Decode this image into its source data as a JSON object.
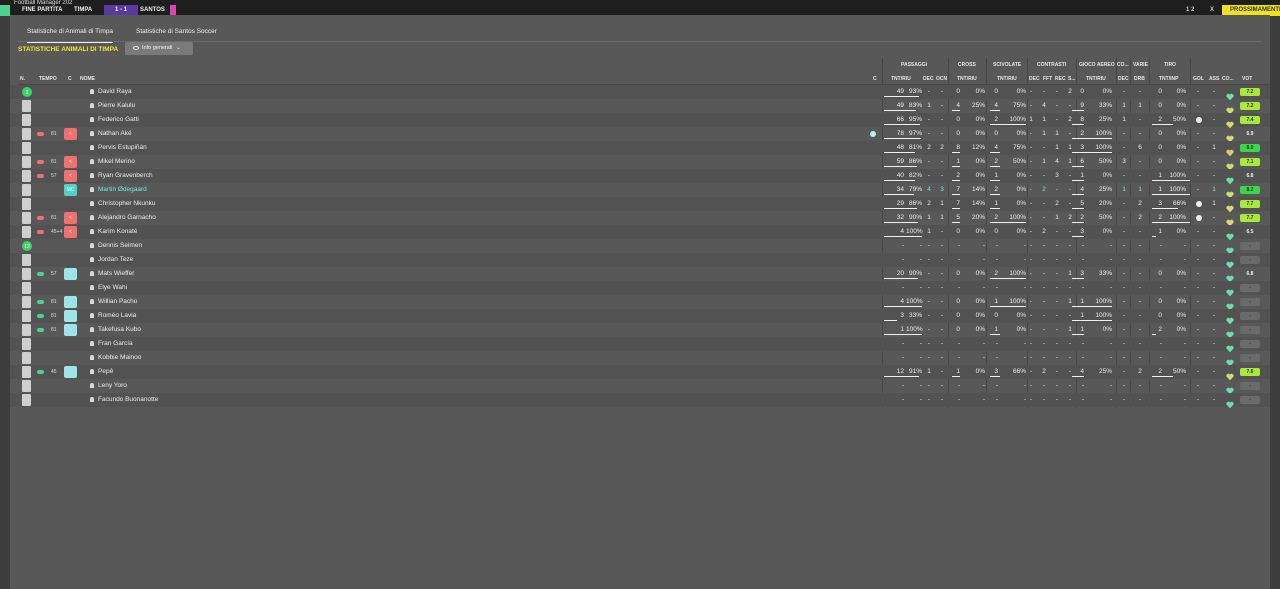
{
  "top_bar": {
    "title_snippet": "Football Manager 202",
    "status": "FINE PARTITA",
    "home": "TIMPA",
    "score": "1 - 1",
    "away": "SANTOS",
    "right_score": "1 2",
    "right_close": "X",
    "right_button": "PROSSIMAMENTE"
  },
  "tabs": [
    {
      "label": "Statistiche di Animali di Timpa",
      "active": true
    },
    {
      "label": "Statistiche di Santos Soccer",
      "active": false
    }
  ],
  "heading": "STATISTICHE ANIMALI DI TIMPA",
  "dropdown": {
    "icon": "eye-icon",
    "label": "Info generali",
    "chevron": "chevron-down-icon"
  },
  "columns": {
    "groups": [
      "PASSAGGI",
      "CROSS",
      "SCIVOLATE",
      "CONTRASTI",
      "GIOCO AEREO",
      "CO...",
      "VARIE",
      "TIRO"
    ],
    "left": [
      "N.",
      "TEMPO",
      "C",
      "NOME",
      "C"
    ],
    "stats": [
      "TNT/RIU",
      "DEC",
      "OCN",
      "TNT/RIU",
      "TNT/RIU",
      "DEC",
      "FFT",
      "REC",
      "S...",
      "TNT/RIU",
      "DEC",
      "DRB",
      "TNT/INP",
      "GOL",
      "ASS",
      "CO...",
      "VOT"
    ]
  },
  "players": [
    {
      "name": "David Raya",
      "kit": "1",
      "kit_style": "green",
      "time": "",
      "pos": "",
      "pos_style": "",
      "sub": "",
      "pass": [
        "49",
        "93%"
      ],
      "pass_bar": 0.93,
      "dec": "-",
      "ocn": "-",
      "cross": [
        "0",
        "0%"
      ],
      "scivolate": [
        "0",
        "0%"
      ],
      "contrasti": [
        "-",
        "-",
        "-",
        "2"
      ],
      "aereo": [
        "0",
        "0%"
      ],
      "co": "-",
      "drb": "-",
      "tiro": [
        "0",
        "0%"
      ],
      "tiro_bar": 0,
      "gol": "-",
      "ass": "-",
      "heart": "#6fe0a2",
      "vote": "7.2",
      "vote_bg": "#a8e83c",
      "dot": false,
      "ball": false
    },
    {
      "name": "Pierre Kalulu",
      "kit": "",
      "kit_style": "grey",
      "time": "",
      "pos": "",
      "pos_style": "",
      "sub": "",
      "pass": [
        "49",
        "83%"
      ],
      "pass_bar": 0.83,
      "dec": "1",
      "ocn": "-",
      "cross": [
        "4",
        "25%"
      ],
      "scivolate": [
        "4",
        "75%"
      ],
      "contrasti": [
        "-",
        "4",
        "-",
        "-"
      ],
      "aereo": [
        "9",
        "33%"
      ],
      "co": "1",
      "drb": "1",
      "tiro": [
        "0",
        "0%"
      ],
      "tiro_bar": 0,
      "gol": "-",
      "ass": "-",
      "heart": "#c7e06f",
      "vote": "7.2",
      "vote_bg": "#a8e83c",
      "dot": false,
      "ball": false
    },
    {
      "name": "Federico Gatti",
      "kit": "",
      "kit_style": "grey",
      "time": "",
      "pos": "",
      "pos_style": "",
      "sub": "",
      "pass": [
        "66",
        "95%"
      ],
      "pass_bar": 0.95,
      "dec": "-",
      "ocn": "-",
      "cross": [
        "0",
        "0%"
      ],
      "scivolate": [
        "2",
        "100%"
      ],
      "contrasti": [
        "1",
        "1",
        "-",
        "2"
      ],
      "aereo": [
        "8",
        "25%"
      ],
      "co": "1",
      "drb": "-",
      "tiro": [
        "2",
        "50%"
      ],
      "tiro_bar": 0.5,
      "gol": "ball",
      "ass": "-",
      "heart": "#e0d66f",
      "vote": "7.4",
      "vote_bg": "#a8e83c",
      "dot": false,
      "ball": true
    },
    {
      "name": "Nathan Aké",
      "kit": "",
      "kit_style": "grey",
      "time": "81",
      "pos": "<",
      "pos_style": "red",
      "sub": "#f07070",
      "pass": [
        "78",
        "97%"
      ],
      "pass_bar": 0.97,
      "dec": "-",
      "ocn": "-",
      "cross": [
        "0",
        "0%"
      ],
      "scivolate": [
        "0",
        "0%"
      ],
      "contrasti": [
        "-",
        "1",
        "1",
        "-"
      ],
      "aereo": [
        "2",
        "100%"
      ],
      "co": "-",
      "drb": "-",
      "tiro": [
        "0",
        "0%"
      ],
      "tiro_bar": 0,
      "gol": "-",
      "ass": "-",
      "heart": "#e0d66f",
      "vote": "6.9",
      "vote_bg": "",
      "dot": true,
      "ball": false
    },
    {
      "name": "Pervis Estupiñán",
      "kit": "",
      "kit_style": "grey",
      "time": "",
      "pos": "",
      "pos_style": "",
      "sub": "",
      "pass": [
        "48",
        "81%"
      ],
      "pass_bar": 0.81,
      "dec": "2",
      "ocn": "2",
      "cross": [
        "8",
        "12%"
      ],
      "scivolate": [
        "4",
        "75%"
      ],
      "contrasti": [
        "-",
        "-",
        "1",
        "1"
      ],
      "aereo": [
        "3",
        "100%"
      ],
      "co": "-",
      "drb": "6",
      "tiro": [
        "0",
        "0%"
      ],
      "tiro_bar": 0,
      "gol": "-",
      "ass": "1",
      "heart": "#e0c86f",
      "vote": "8.0",
      "vote_bg": "#3cd64c",
      "dot": false,
      "ball": false
    },
    {
      "name": "Mikel Merino",
      "kit": "",
      "kit_style": "grey",
      "time": "81",
      "pos": "<",
      "pos_style": "red",
      "sub": "#f07070",
      "pass": [
        "59",
        "86%"
      ],
      "pass_bar": 0.86,
      "dec": "-",
      "ocn": "-",
      "cross": [
        "1",
        "0%"
      ],
      "scivolate": [
        "2",
        "50%"
      ],
      "contrasti": [
        "-",
        "1",
        "4",
        "1"
      ],
      "aereo": [
        "6",
        "50%"
      ],
      "co": "3",
      "drb": "-",
      "tiro": [
        "0",
        "0%"
      ],
      "tiro_bar": 0,
      "gol": "-",
      "ass": "-",
      "heart": "#c7e06f",
      "vote": "7.1",
      "vote_bg": "#a8e83c",
      "dot": false,
      "ball": false
    },
    {
      "name": "Ryan Gravenberch",
      "kit": "",
      "kit_style": "grey",
      "time": "57",
      "pos": "<",
      "pos_style": "red",
      "sub": "#f07070",
      "pass": [
        "40",
        "82%"
      ],
      "pass_bar": 0.82,
      "dec": "-",
      "ocn": "-",
      "cross": [
        "2",
        "0%"
      ],
      "scivolate": [
        "1",
        "0%"
      ],
      "contrasti": [
        "-",
        "-",
        "3",
        "-"
      ],
      "aereo": [
        "1",
        "0%"
      ],
      "co": "-",
      "drb": "-",
      "tiro": [
        "1",
        "100%"
      ],
      "tiro_bar": 1,
      "gol": "-",
      "ass": "-",
      "heart": "#6fe0a2",
      "vote": "6.8",
      "vote_bg": "",
      "dot": false,
      "ball": false
    },
    {
      "name": "Martin Ødegaard",
      "kit": "",
      "kit_style": "grey",
      "time": "",
      "pos": "MC",
      "pos_style": "teal",
      "sub": "",
      "pass": [
        "34",
        "79%"
      ],
      "pass_bar": 0.79,
      "dec": "4",
      "ocn": "3",
      "cross": [
        "7",
        "14%"
      ],
      "scivolate": [
        "2",
        "0%"
      ],
      "contrasti": [
        "-",
        "2",
        "-",
        "-"
      ],
      "aereo": [
        "4",
        "25%"
      ],
      "co": "1",
      "drb": "1",
      "tiro": [
        "1",
        "100%"
      ],
      "tiro_bar": 1,
      "gol": "-",
      "ass": "1",
      "heart": "#c7e06f",
      "vote": "8.2",
      "vote_bg": "#3cd64c",
      "dot": false,
      "ball": false,
      "highlight": true
    },
    {
      "name": "Christopher Nkunku",
      "kit": "",
      "kit_style": "grey",
      "time": "",
      "pos": "",
      "pos_style": "",
      "sub": "",
      "pass": [
        "29",
        "86%"
      ],
      "pass_bar": 0.86,
      "dec": "2",
      "ocn": "1",
      "cross": [
        "7",
        "14%"
      ],
      "scivolate": [
        "1",
        "0%"
      ],
      "contrasti": [
        "-",
        "-",
        "2",
        "-"
      ],
      "aereo": [
        "5",
        "20%"
      ],
      "co": "-",
      "drb": "2",
      "tiro": [
        "3",
        "66%"
      ],
      "tiro_bar": 0.66,
      "gol": "ball",
      "ass": "1",
      "heart": "#e0d66f",
      "vote": "7.7",
      "vote_bg": "#a8e83c",
      "dot": false,
      "ball": true
    },
    {
      "name": "Alejandro Garnacho",
      "kit": "",
      "kit_style": "grey",
      "time": "81",
      "pos": "<",
      "pos_style": "red",
      "sub": "#f07070",
      "pass": [
        "32",
        "90%"
      ],
      "pass_bar": 0.9,
      "dec": "1",
      "ocn": "1",
      "cross": [
        "5",
        "20%"
      ],
      "scivolate": [
        "2",
        "100%"
      ],
      "contrasti": [
        "-",
        "-",
        "1",
        "2"
      ],
      "aereo": [
        "2",
        "50%"
      ],
      "co": "-",
      "drb": "2",
      "tiro": [
        "2",
        "100%"
      ],
      "tiro_bar": 1,
      "gol": "ball",
      "ass": "-",
      "heart": "#e0d66f",
      "vote": "7.7",
      "vote_bg": "#a8e83c",
      "dot": false,
      "ball": true
    },
    {
      "name": "Karim Konaté",
      "kit": "",
      "kit_style": "grey",
      "time": "45+4",
      "pos": "<",
      "pos_style": "red",
      "sub": "#f07070",
      "pass": [
        "4",
        "100%"
      ],
      "pass_bar": 1,
      "dec": "1",
      "ocn": "-",
      "cross": [
        "0",
        "0%"
      ],
      "scivolate": [
        "0",
        "0%"
      ],
      "contrasti": [
        "-",
        "2",
        "-",
        "-"
      ],
      "aereo": [
        "3",
        "0%"
      ],
      "co": "-",
      "drb": "-",
      "tiro": [
        "1",
        "0%"
      ],
      "tiro_bar": 0,
      "gol": "-",
      "ass": "-",
      "heart": "#6fe0a2",
      "vote": "6.5",
      "vote_bg": "",
      "dot": false,
      "ball": false
    },
    {
      "name": "Dennis Seimen",
      "kit": "12",
      "kit_style": "green",
      "time": "",
      "pos": "",
      "pos_style": "",
      "sub": "",
      "pass": [
        "-",
        "-"
      ],
      "pass_bar": 0,
      "dec": "-",
      "ocn": "-",
      "cross": [
        "-",
        "-"
      ],
      "scivolate": [
        "-",
        "-"
      ],
      "contrasti": [
        "-",
        "-",
        "-",
        "-"
      ],
      "aereo": [
        "-",
        "-"
      ],
      "co": "-",
      "drb": "-",
      "tiro": [
        "-",
        "-"
      ],
      "tiro_bar": 0,
      "gol": "-",
      "ass": "-",
      "heart": "#6fe0a2",
      "vote": "-",
      "vote_bg": "#6a6a6a",
      "dot": false,
      "ball": false,
      "dashed": true
    },
    {
      "name": "Jordan Teze",
      "kit": "",
      "kit_style": "grey",
      "time": "",
      "pos": "",
      "pos_style": "",
      "sub": "",
      "pass": [
        "-",
        "-"
      ],
      "pass_bar": 0,
      "dec": "-",
      "ocn": "-",
      "cross": [
        "-",
        "-"
      ],
      "scivolate": [
        "-",
        "-"
      ],
      "contrasti": [
        "-",
        "-",
        "-",
        "-"
      ],
      "aereo": [
        "-",
        "-"
      ],
      "co": "-",
      "drb": "-",
      "tiro": [
        "-",
        "-"
      ],
      "tiro_bar": 0,
      "gol": "-",
      "ass": "-",
      "heart": "#6fe0a2",
      "vote": "-",
      "vote_bg": "#6a6a6a",
      "dot": false,
      "ball": false,
      "dashed": true
    },
    {
      "name": "Mats Wieffer",
      "kit": "",
      "kit_style": "grey",
      "time": "57",
      "pos": "",
      "pos_style": "teal-light",
      "sub": "#4fd08c",
      "pass": [
        "20",
        "90%"
      ],
      "pass_bar": 0.9,
      "dec": "-",
      "ocn": "-",
      "cross": [
        "0",
        "0%"
      ],
      "scivolate": [
        "2",
        "100%"
      ],
      "contrasti": [
        "-",
        "-",
        "-",
        "1"
      ],
      "aereo": [
        "3",
        "33%"
      ],
      "co": "-",
      "drb": "-",
      "tiro": [
        "0",
        "0%"
      ],
      "tiro_bar": 0,
      "gol": "-",
      "ass": "-",
      "heart": "#6fe0a2",
      "vote": "6.8",
      "vote_bg": "",
      "dot": false,
      "ball": false
    },
    {
      "name": "Elye Wahi",
      "kit": "",
      "kit_style": "grey",
      "time": "",
      "pos": "",
      "pos_style": "",
      "sub": "",
      "pass": [
        "-",
        "-"
      ],
      "pass_bar": 0,
      "dec": "-",
      "ocn": "-",
      "cross": [
        "-",
        "-"
      ],
      "scivolate": [
        "-",
        "-"
      ],
      "contrasti": [
        "-",
        "-",
        "-",
        "-"
      ],
      "aereo": [
        "-",
        "-"
      ],
      "co": "-",
      "drb": "-",
      "tiro": [
        "-",
        "-"
      ],
      "tiro_bar": 0,
      "gol": "-",
      "ass": "-",
      "heart": "#6fe0a2",
      "vote": "-",
      "vote_bg": "#6a6a6a",
      "dot": false,
      "ball": false,
      "dashed": true
    },
    {
      "name": "Willian Pacho",
      "kit": "",
      "kit_style": "grey",
      "time": "81",
      "pos": "",
      "pos_style": "teal-light",
      "sub": "#4fd08c",
      "pass": [
        "4",
        "100%"
      ],
      "pass_bar": 1,
      "dec": "-",
      "ocn": "-",
      "cross": [
        "0",
        "0%"
      ],
      "scivolate": [
        "1",
        "100%"
      ],
      "contrasti": [
        "-",
        "-",
        "-",
        "1"
      ],
      "aereo": [
        "1",
        "100%"
      ],
      "co": "-",
      "drb": "-",
      "tiro": [
        "0",
        "0%"
      ],
      "tiro_bar": 0,
      "gol": "-",
      "ass": "-",
      "heart": "#6fe0a2",
      "vote": "-",
      "vote_bg": "#6a6a6a",
      "dot": false,
      "ball": false
    },
    {
      "name": "Roméo Lavia",
      "kit": "",
      "kit_style": "grey",
      "time": "81",
      "pos": "",
      "pos_style": "teal-light",
      "sub": "#4fd08c",
      "pass": [
        "3",
        "33%"
      ],
      "pass_bar": 0.33,
      "dec": "-",
      "ocn": "-",
      "cross": [
        "0",
        "0%"
      ],
      "scivolate": [
        "0",
        "0%"
      ],
      "contrasti": [
        "-",
        "-",
        "-",
        "-"
      ],
      "aereo": [
        "1",
        "100%"
      ],
      "co": "-",
      "drb": "-",
      "tiro": [
        "0",
        "0%"
      ],
      "tiro_bar": 0,
      "gol": "-",
      "ass": "-",
      "heart": "#6fe0a2",
      "vote": "-",
      "vote_bg": "#6a6a6a",
      "dot": false,
      "ball": false
    },
    {
      "name": "Takefusa Kubo",
      "kit": "",
      "kit_style": "grey",
      "time": "81",
      "pos": "",
      "pos_style": "teal-light",
      "sub": "#4fd08c",
      "pass": [
        "1",
        "100%"
      ],
      "pass_bar": 1,
      "dec": "-",
      "ocn": "-",
      "cross": [
        "0",
        "0%"
      ],
      "scivolate": [
        "1",
        "0%"
      ],
      "contrasti": [
        "-",
        "-",
        "-",
        "1"
      ],
      "aereo": [
        "1",
        "0%"
      ],
      "co": "-",
      "drb": "-",
      "tiro": [
        "2",
        "0%"
      ],
      "tiro_bar": 0,
      "gol": "-",
      "ass": "-",
      "heart": "#6fe0a2",
      "vote": "-",
      "vote_bg": "#6a6a6a",
      "dot": false,
      "ball": false
    },
    {
      "name": "Fran García",
      "kit": "",
      "kit_style": "grey",
      "time": "",
      "pos": "",
      "pos_style": "",
      "sub": "",
      "pass": [
        "-",
        "-"
      ],
      "pass_bar": 0,
      "dec": "-",
      "ocn": "-",
      "cross": [
        "-",
        "-"
      ],
      "scivolate": [
        "-",
        "-"
      ],
      "contrasti": [
        "-",
        "-",
        "-",
        "-"
      ],
      "aereo": [
        "-",
        "-"
      ],
      "co": "-",
      "drb": "-",
      "tiro": [
        "-",
        "-"
      ],
      "tiro_bar": 0,
      "gol": "-",
      "ass": "-",
      "heart": "#6fe0a2",
      "vote": "-",
      "vote_bg": "#6a6a6a",
      "dot": false,
      "ball": false,
      "dashed": true
    },
    {
      "name": "Kobbie Mainoo",
      "kit": "",
      "kit_style": "grey",
      "time": "",
      "pos": "",
      "pos_style": "",
      "sub": "",
      "pass": [
        "-",
        "-"
      ],
      "pass_bar": 0,
      "dec": "-",
      "ocn": "-",
      "cross": [
        "-",
        "-"
      ],
      "scivolate": [
        "-",
        "-"
      ],
      "contrasti": [
        "-",
        "-",
        "-",
        "-"
      ],
      "aereo": [
        "-",
        "-"
      ],
      "co": "-",
      "drb": "-",
      "tiro": [
        "-",
        "-"
      ],
      "tiro_bar": 0,
      "gol": "-",
      "ass": "-",
      "heart": "#6fe0a2",
      "vote": "-",
      "vote_bg": "#6a6a6a",
      "dot": false,
      "ball": false,
      "dashed": true
    },
    {
      "name": "Pepê",
      "kit": "",
      "kit_style": "grey",
      "time": "45",
      "pos": "",
      "pos_style": "teal-light",
      "sub": "#4fd08c",
      "pass": [
        "12",
        "91%"
      ],
      "pass_bar": 0.91,
      "dec": "1",
      "ocn": "-",
      "cross": [
        "1",
        "0%"
      ],
      "scivolate": [
        "3",
        "66%"
      ],
      "contrasti": [
        "-",
        "2",
        "-",
        "-"
      ],
      "aereo": [
        "4",
        "25%"
      ],
      "co": "-",
      "drb": "2",
      "tiro": [
        "2",
        "50%"
      ],
      "tiro_bar": 0.5,
      "gol": "-",
      "ass": "-",
      "heart": "#c7e06f",
      "vote": "7.6",
      "vote_bg": "#a8e83c",
      "dot": false,
      "ball": false
    },
    {
      "name": "Leny Yoro",
      "kit": "",
      "kit_style": "grey",
      "time": "",
      "pos": "",
      "pos_style": "",
      "sub": "",
      "pass": [
        "-",
        "-"
      ],
      "pass_bar": 0,
      "dec": "-",
      "ocn": "-",
      "cross": [
        "-",
        "-"
      ],
      "scivolate": [
        "-",
        "-"
      ],
      "contrasti": [
        "-",
        "-",
        "-",
        "-"
      ],
      "aereo": [
        "-",
        "-"
      ],
      "co": "-",
      "drb": "-",
      "tiro": [
        "-",
        "-"
      ],
      "tiro_bar": 0,
      "gol": "-",
      "ass": "-",
      "heart": "#6fe0a2",
      "vote": "-",
      "vote_bg": "#6a6a6a",
      "dot": false,
      "ball": false,
      "dashed": true
    },
    {
      "name": "Facundo Buonanotte",
      "kit": "",
      "kit_style": "grey",
      "time": "",
      "pos": "",
      "pos_style": "",
      "sub": "",
      "pass": [
        "-",
        "-"
      ],
      "pass_bar": 0,
      "dec": "-",
      "ocn": "-",
      "cross": [
        "-",
        "-"
      ],
      "scivolate": [
        "-",
        "-"
      ],
      "contrasti": [
        "-",
        "-",
        "-",
        "-"
      ],
      "aereo": [
        "-",
        "-"
      ],
      "co": "-",
      "drb": "-",
      "tiro": [
        "-",
        "-"
      ],
      "tiro_bar": 0,
      "gol": "-",
      "ass": "-",
      "heart": "#6fe0a2",
      "vote": "-",
      "vote_bg": "#6a6a6a",
      "dot": false,
      "ball": false,
      "dashed": true
    }
  ]
}
